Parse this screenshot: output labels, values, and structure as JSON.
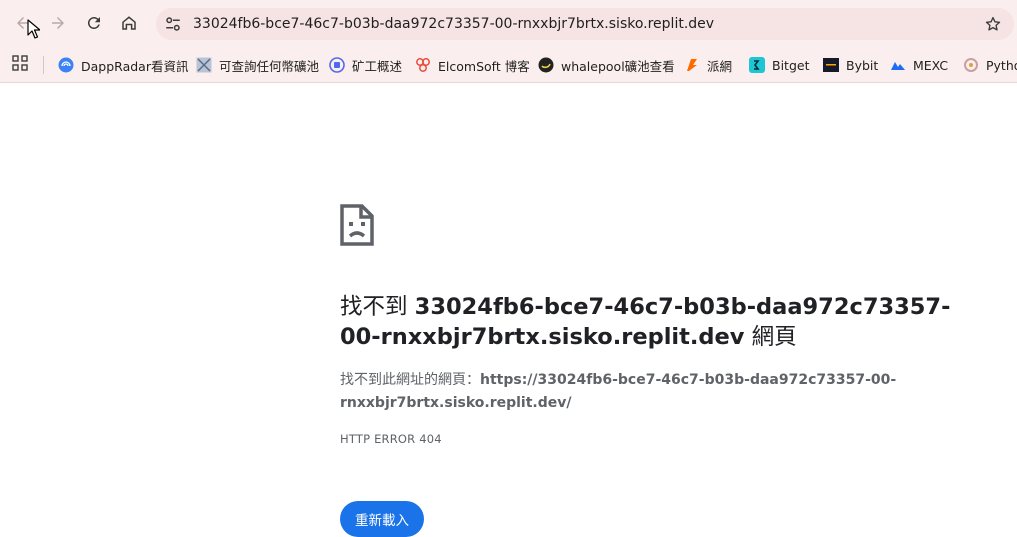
{
  "browser": {
    "url": "33024fb6-bce7-46c7-b03b-daa972c73357-00-rnxxbjr7brtx.sisko.replit.dev",
    "nav": {
      "back_icon": "arrow-left-icon",
      "forward_icon": "arrow-right-icon",
      "reload_icon": "reload-icon",
      "home_icon": "home-icon"
    }
  },
  "bookmarks": [
    {
      "label": "DappRadar看資訊",
      "icon": "dappradar-icon",
      "color": "#3b82f6"
    },
    {
      "label": "可查詢任何幣礦池",
      "icon": "pool-icon",
      "color": "#7c8ca6"
    },
    {
      "label": "矿工概述",
      "icon": "miner-icon",
      "color": "#4f6bed"
    },
    {
      "label": "ElcomSoft 博客",
      "icon": "elcomsoft-icon",
      "color": "#e74c3c"
    },
    {
      "label": "whalepool礦池查看",
      "icon": "whalepool-icon",
      "color": "#222222"
    },
    {
      "label": "派網",
      "icon": "pionex-icon",
      "color": "#ff6a00"
    },
    {
      "label": "Bitget",
      "icon": "bitget-icon",
      "color": "#1cc6d5"
    },
    {
      "label": "Bybit",
      "icon": "bybit-icon",
      "color": "#15192a"
    },
    {
      "label": "MEXC",
      "icon": "mexc-icon",
      "color": "#1d6cf5"
    },
    {
      "label": "Pytho",
      "icon": "python-icon",
      "color": "#e0a040"
    }
  ],
  "error": {
    "title_prefix": "找不到",
    "title_host": "33024fb6-bce7-46c7-b03b-daa972c73357-00-rnxxbjr7brtx.sisko.replit.dev",
    "title_suffix": "網頁",
    "desc_prefix": "找不到此網址的網頁：",
    "desc_url": "https://33024fb6-bce7-46c7-b03b-daa972c73357-00-rnxxbjr7brtx.sisko.replit.dev/",
    "code": "HTTP ERROR 404",
    "reload_label": "重新載入"
  },
  "colors": {
    "accent": "#1a73e8",
    "toolbar_bg": "#fbeeee"
  }
}
